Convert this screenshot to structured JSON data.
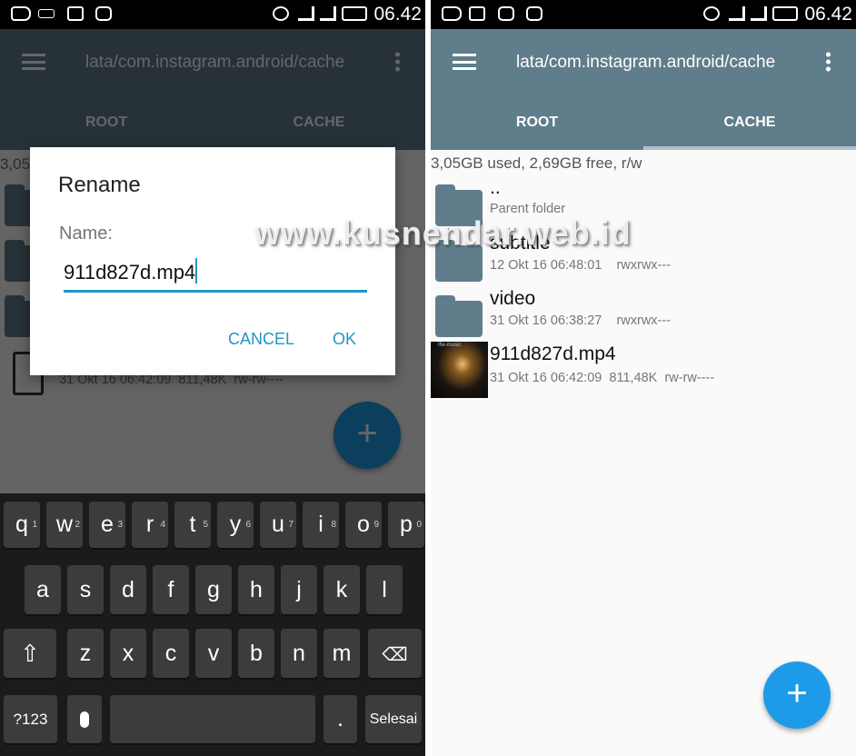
{
  "status_bar": {
    "time": "06.42",
    "left_icons": [
      "add-icon",
      "keyboard-icon",
      "image-icon",
      "bbm-icon"
    ],
    "right_icons": [
      "alarm-icon",
      "signal-icon",
      "signal-icon",
      "battery-icon"
    ]
  },
  "toolbar": {
    "path": "lata/com.instagram.android/cache",
    "menu_icon": "hamburger-icon",
    "overflow_icon": "more-vert-icon"
  },
  "tabs": [
    {
      "label": "ROOT"
    },
    {
      "label": "CACHE",
      "selected": true
    }
  ],
  "storage": {
    "text": "3,05GB used, 2,69GB free, r/w",
    "truncated": "3,05"
  },
  "files": [
    {
      "name": "..",
      "meta": "Parent folder",
      "type": "folder"
    },
    {
      "name": "subtitle",
      "meta": "12 Okt 16 06:48:01    rwxrwx---",
      "type": "folder"
    },
    {
      "name": "video",
      "meta": "31 Okt 16 06:38:27    rwxrwx---",
      "type": "folder"
    },
    {
      "name": "911d827d.mp4",
      "meta": "31 Okt 16 06:42:09  811,48K  rw-rw----",
      "type": "video",
      "thumb_text": "Ifw-music"
    }
  ],
  "dialog": {
    "title": "Rename",
    "label": "Name:",
    "value": "911d827d.mp4",
    "cancel": "CANCEL",
    "ok": "OK"
  },
  "keyboard": {
    "row1": [
      [
        "q",
        "1"
      ],
      [
        "w",
        "2"
      ],
      [
        "e",
        "3"
      ],
      [
        "r",
        "4"
      ],
      [
        "t",
        "5"
      ],
      [
        "y",
        "6"
      ],
      [
        "u",
        "7"
      ],
      [
        "i",
        "8"
      ],
      [
        "o",
        "9"
      ],
      [
        "p",
        "0"
      ]
    ],
    "row2": [
      "a",
      "s",
      "d",
      "f",
      "g",
      "h",
      "j",
      "k",
      "l"
    ],
    "row3": [
      "z",
      "x",
      "c",
      "v",
      "b",
      "n",
      "m"
    ],
    "symbols": "?123",
    "period": ".",
    "enter": "Selesai"
  },
  "fab": {
    "icon": "plus",
    "label": "+"
  },
  "watermark": "www.kusnendar.web.id",
  "colors": {
    "primary": "#607d8b",
    "accent": "#1e9be8",
    "dialog_accent": "#2196c4",
    "tab_indicator": "#b0bec5"
  }
}
